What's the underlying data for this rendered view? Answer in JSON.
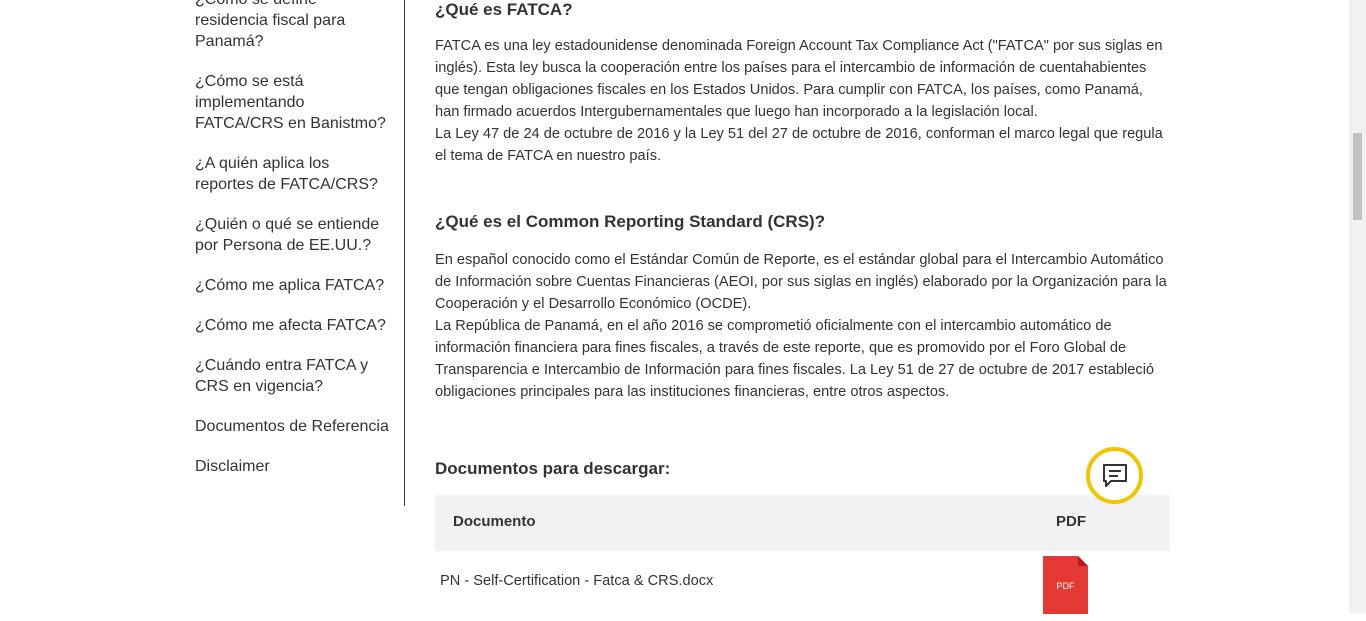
{
  "sidebar": {
    "items": [
      {
        "label": "¿Cómo se define residencia fiscal para Panamá?"
      },
      {
        "label": "¿Cómo se está implementando FATCA/CRS en Banistmo?"
      },
      {
        "label": "¿A quién aplica los reportes de FATCA/CRS?"
      },
      {
        "label": "¿Quién o qué se entiende por Persona de EE.UU.?"
      },
      {
        "label": "¿Cómo me aplica FATCA?"
      },
      {
        "label": "¿Cómo me afecta FATCA?"
      },
      {
        "label": "¿Cuándo entra FATCA y CRS en vigencia?"
      },
      {
        "label": "Documentos de Referencia"
      },
      {
        "label": "Disclaimer"
      }
    ]
  },
  "main": {
    "fatca_title": "¿Qué es FATCA?",
    "fatca_p1": "FATCA es una ley estadounidense denominada Foreign Account Tax Compliance Act (\"FATCA\" por sus siglas en inglés). Esta ley busca la cooperación entre los países para el intercambio de información de cuentahabientes que tengan obligaciones fiscales en los Estados Unidos. Para cumplir con FATCA, los países, como Panamá, han firmado acuerdos Intergubernamentales que luego han incorporado a la legislación local.",
    "fatca_p2": "La Ley 47 de 24 de octubre de 2016 y la Ley 51 del 27 de octubre de 2016, conforman el marco legal que regula el tema de FATCA en nuestro país.",
    "crs_title": "¿Qué es el Common Reporting Standard (CRS)?",
    "crs_p1": "En español conocido como el Estándar Común de Reporte, es el estándar global para el Intercambio Automático de Información sobre Cuentas Financieras (AEOI, por sus siglas en inglés) elaborado por la Organización para la Cooperación y el Desarrollo Económico (OCDE).",
    "crs_p2": "La República de Panamá, en el año 2016 se comprometió oficialmente con el intercambio automático de información financiera para fines fiscales, a través de este reporte,  que es promovido por el Foro Global de Transparencia e Intercambio de Información para fines fiscales.  La Ley 51 de 27 de octubre de 2017 estableció obligaciones principales para las instituciones financieras, entre otros aspectos.",
    "docs_title": "Documentos para descargar:",
    "table": {
      "headers": [
        "Documento",
        "PDF"
      ],
      "rows": [
        {
          "name": "PN - Self-Certification - Fatca & CRS.docx",
          "icon_label": "PDF"
        }
      ]
    }
  },
  "chat": {
    "icon": "chat-icon",
    "accent": "#f2c400"
  },
  "colors": {
    "pdf_red": "#e53935",
    "header_bg": "#f2f2f2"
  }
}
